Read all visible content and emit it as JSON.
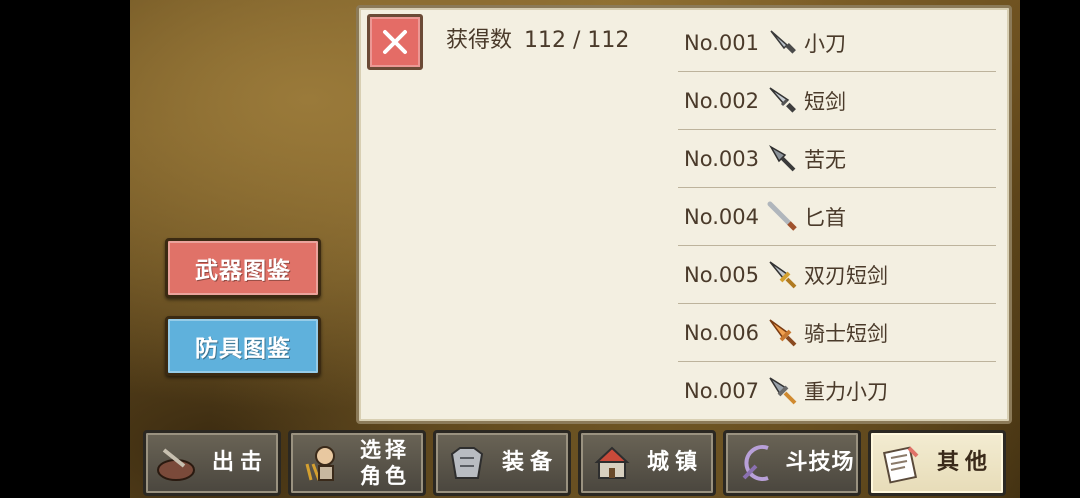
{
  "sidebar": {
    "weapons_label": "武器图鉴",
    "armor_label": "防具图鉴"
  },
  "panel": {
    "count_label": "获得数",
    "count_value": "112 / 112",
    "items": [
      {
        "no": "No.001",
        "name": "小刀",
        "icon": "knife-icon"
      },
      {
        "no": "No.002",
        "name": "短剑",
        "icon": "short-sword-icon"
      },
      {
        "no": "No.003",
        "name": "苦无",
        "icon": "kunai-icon"
      },
      {
        "no": "No.004",
        "name": "匕首",
        "icon": "dagger-icon"
      },
      {
        "no": "No.005",
        "name": "双刃短剑",
        "icon": "twin-blade-icon"
      },
      {
        "no": "No.006",
        "name": "骑士短剑",
        "icon": "knight-sword-icon"
      },
      {
        "no": "No.007",
        "name": "重力小刀",
        "icon": "gravity-knife-icon"
      }
    ]
  },
  "nav": {
    "items": [
      {
        "label": "出击",
        "icon": "sortie-icon"
      },
      {
        "label": "选择角色",
        "line1": "选择",
        "line2": "角色",
        "icon": "character-icon"
      },
      {
        "label": "装备",
        "icon": "armor-icon"
      },
      {
        "label": "城镇",
        "icon": "town-icon"
      },
      {
        "label": "斗技场",
        "icon": "arena-icon"
      },
      {
        "label": "其他",
        "icon": "scroll-icon"
      }
    ],
    "active_index": 5
  },
  "colors": {
    "weapons_button": "#e07268",
    "armor_button": "#5fb1dc",
    "close_button": "#e46c66",
    "panel_bg": "#f3efe1",
    "text": "#4a3a2a"
  }
}
